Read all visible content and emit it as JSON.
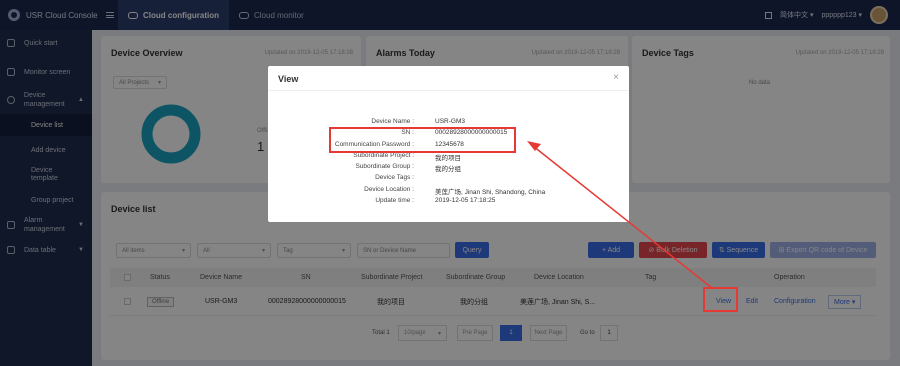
{
  "app": {
    "title": "USR Cloud Console",
    "tabs": [
      {
        "label": "Cloud configuration",
        "active": true
      },
      {
        "label": "Cloud monitor",
        "active": false
      }
    ],
    "language": "简体中文 ▾",
    "user": "pppppp123 ▾"
  },
  "sidebar": {
    "items": [
      {
        "label": "Quick start"
      },
      {
        "label": "Monitor screen"
      },
      {
        "label": "Device management",
        "expanded": true,
        "children": [
          {
            "label": "Device list",
            "selected": true
          },
          {
            "label": "Add device"
          },
          {
            "label": "Device template"
          },
          {
            "label": "Group project"
          }
        ]
      },
      {
        "label": "Alarm management"
      },
      {
        "label": "Data table"
      }
    ]
  },
  "overview": {
    "title": "Device Overview",
    "updated": "Updated on 2019-12-05 17:18:28",
    "projects": "All Projects",
    "offline_label": "Offline",
    "count": "1"
  },
  "alarms": {
    "title": "Alarms Today",
    "updated": "Updated on 2019-12-05 17:18:28"
  },
  "tags": {
    "title": "Device Tags",
    "updated": "Updated on 2019-12-05 17:18:28",
    "nodata": "No data"
  },
  "device_list": {
    "title": "Device list",
    "filters": {
      "items": "All items",
      "all": "All",
      "tag": "Tag",
      "search_placeholder": "SN or Device Name",
      "query": "Query"
    },
    "buttons": {
      "add": "+ Add",
      "bulk_delete": "⊘ Bulk Deletion",
      "sequence": "⇅ Sequence",
      "export": "⊞ Export QR code of Device"
    },
    "columns": [
      "Status",
      "Device Name",
      "SN",
      "Subordinate Project",
      "Subordinate Group",
      "Device Location",
      "Tag",
      "Operation"
    ],
    "rows": [
      {
        "status": "Offline",
        "name": "USR-GM3",
        "sn": "00028928000000000015",
        "project": "我的项目",
        "group": "我的分组",
        "location": "美莲广场, Jinan Shi, S...",
        "tag": "",
        "ops": [
          "View",
          "Edit",
          "Configuration",
          "More ▾"
        ]
      }
    ],
    "pagination": {
      "total": "Total 1",
      "per_page": "10/page",
      "prev": "Pre Page",
      "page": "1",
      "next": "Next Page",
      "goto": "Go to",
      "goto_value": "1"
    }
  },
  "modal": {
    "title": "View",
    "close": "×",
    "fields": [
      {
        "label": "Device Name :",
        "value": "USR-GM3"
      },
      {
        "label": "SN :",
        "value": "00028928000000000015"
      },
      {
        "label": "Communication Password :",
        "value": "12345678"
      },
      {
        "label": "Subordinate Project :",
        "value": "我的项目"
      },
      {
        "label": "Subordinate Group :",
        "value": "我的分组"
      },
      {
        "label": "Device Tags :",
        "value": ""
      },
      {
        "label": "Device Location :",
        "value": "美莲广场, Jinan Shi, Shandong, China"
      },
      {
        "label": "Update time :",
        "value": "2019-12-05 17:18:25"
      }
    ]
  },
  "colors": {
    "primary": "#3a6ee8",
    "danger": "#e5484d",
    "teal": "#1aa3c0",
    "navy": "#1b2a50",
    "highlight": "#e53935"
  }
}
